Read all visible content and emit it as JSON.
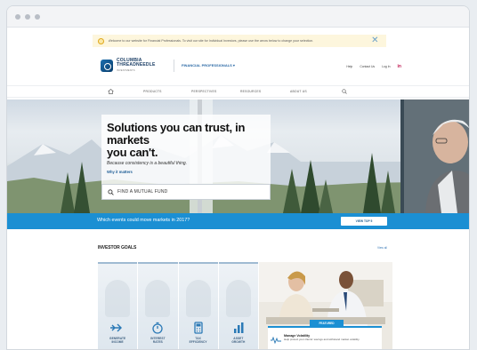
{
  "notice": {
    "text": "Welcome to our website for Financial Professionals. To visit our site for Individual Investors, please use the arrow below to change your selection."
  },
  "header": {
    "logo_line1": "COLUMBIA",
    "logo_line2": "THREADNEEDLE",
    "logo_line3": "INVESTMENTS",
    "audience_label": "FINANCIAL PROFESSIONALS ▾",
    "util": [
      "Help",
      "Contact Us",
      "Log In"
    ],
    "social": "in"
  },
  "nav": {
    "items": [
      "PRODUCTS",
      "PERSPECTIVES",
      "RESOURCES",
      "ABOUT US"
    ]
  },
  "hero": {
    "title_line1": "Solutions you can trust, in markets",
    "title_line2": "you can't.",
    "subtitle": "Because consistency is a beautiful thing.",
    "link": "Why it matters",
    "search_label": "FIND A MUTUAL FUND"
  },
  "strip": {
    "text": "Which events could move markets in 2017?",
    "button": "VIEW TOP 5"
  },
  "goals": {
    "title": "INVESTOR GOALS",
    "more": "View all",
    "tiles": [
      {
        "line1": "GENERATE",
        "line2": "INCOME",
        "icon": "arrow-flow-icon"
      },
      {
        "line1": "INTEREST",
        "line2": "RATES",
        "icon": "stopwatch-icon"
      },
      {
        "line1": "TAX",
        "line2": "EFFICIENCY",
        "icon": "calculator-icon"
      },
      {
        "line1": "ASSET",
        "line2": "GROWTH",
        "icon": "bar-chart-icon"
      }
    ],
    "featured": {
      "tag": "FEATURED",
      "title": "Manage Volatility",
      "desc": "Help protect your clients' savings and withstand market volatility."
    }
  },
  "colors": {
    "brand_blue": "#1b8fd3",
    "logo_navy": "#1c3f66",
    "notice_bg": "#fdf6dd"
  }
}
